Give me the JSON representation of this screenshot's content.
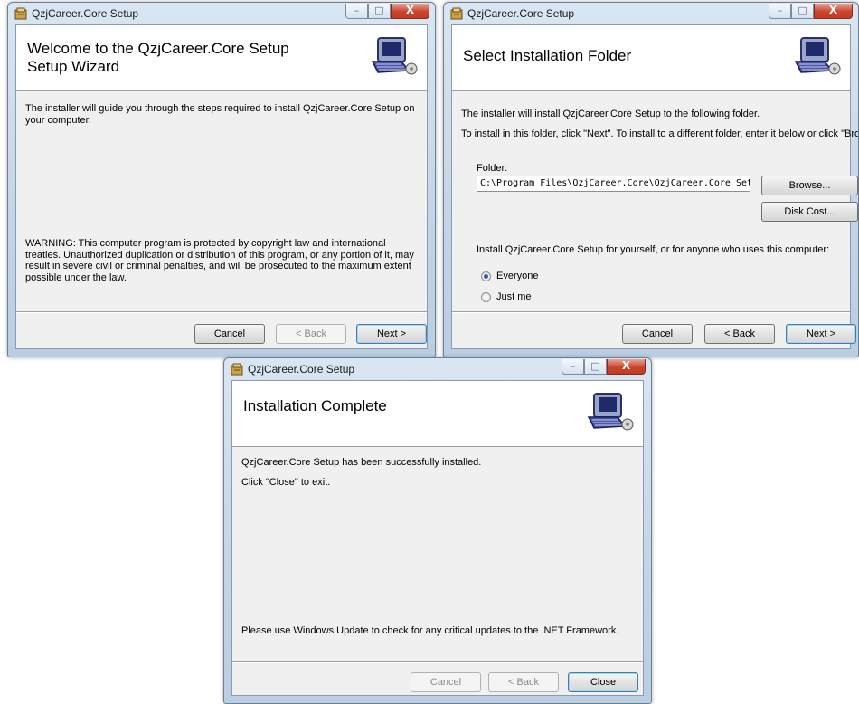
{
  "app": {
    "title": "QzjCareer.Core Setup",
    "caption_glyphs": {
      "minimize": "–",
      "maximize": "□",
      "close": "X"
    }
  },
  "welcome": {
    "heading": "Welcome to the QzjCareer.Core Setup Setup Wizard",
    "intro": "The installer will guide you through the steps required to install QzjCareer.Core Setup on your computer.",
    "warning": "WARNING: This computer program is protected by copyright law and international treaties. Unauthorized duplication or distribution of this program, or any portion of it, may result in severe civil or criminal penalties, and will be prosecuted to the maximum extent possible under the law.",
    "buttons": {
      "cancel": "Cancel",
      "back": "< Back",
      "next": "Next >"
    }
  },
  "folder": {
    "heading": "Select Installation Folder",
    "line1": "The installer will install QzjCareer.Core Setup to the following folder.",
    "line2": "To install in this folder, click \"Next\". To install to a different folder, enter it below or click \"Browse\".",
    "folder_label": "Folder:",
    "folder_value": "C:\\Program Files\\QzjCareer.Core\\QzjCareer.Core Setup\\",
    "browse": "Browse...",
    "disk_cost": "Disk Cost...",
    "install_for": "Install QzjCareer.Core Setup for yourself, or for anyone who uses this computer:",
    "option_everyone": "Everyone",
    "option_just_me": "Just me",
    "buttons": {
      "cancel": "Cancel",
      "back": "< Back",
      "next": "Next >"
    }
  },
  "complete": {
    "heading": "Installation Complete",
    "line1": "QzjCareer.Core Setup has been successfully installed.",
    "line2": "Click \"Close\" to exit.",
    "update_note": "Please use Windows Update to check for any critical updates to the .NET Framework.",
    "buttons": {
      "cancel": "Cancel",
      "back": "< Back",
      "close": "Close"
    }
  }
}
